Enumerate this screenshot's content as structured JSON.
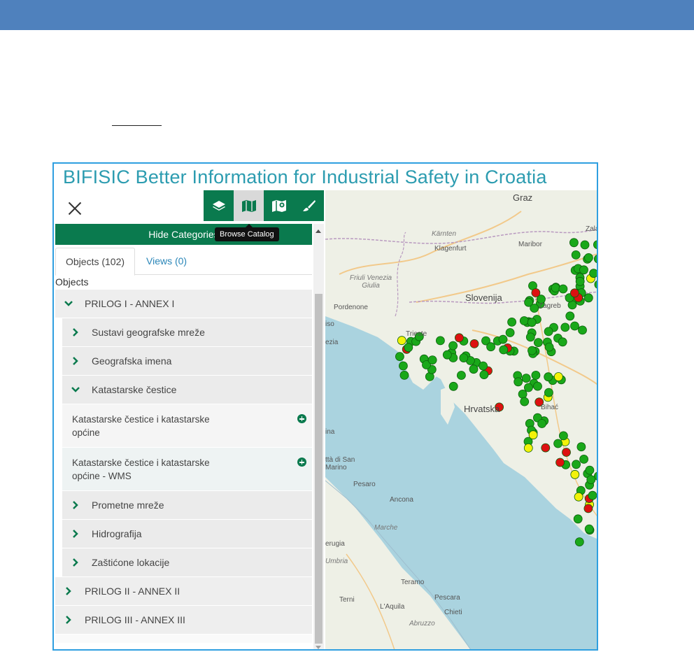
{
  "app": {
    "title": "BIFISIC Better Information for Industrial Safety in Croatia"
  },
  "toolbar": {
    "tools": [
      {
        "icon": "layers-icon"
      },
      {
        "icon": "map-icon"
      },
      {
        "icon": "map-search-icon"
      },
      {
        "icon": "brush-icon"
      }
    ],
    "tooltip": "Browse Catalog"
  },
  "panel": {
    "hide_categories": "Hide Categories",
    "tabs": [
      {
        "label": "Objects (102)"
      },
      {
        "label": "Views (0)"
      }
    ],
    "objects_heading": "Objects",
    "tree": {
      "annex1": "PRILOG I - ANNEX I",
      "annex1_children": [
        "Sustavi geografske mreže",
        "Geografska imena",
        "Katastarske čestice"
      ],
      "katastar_items": [
        "Katastarske čestice i katastarske općine",
        "Katastarske čestice i katastarske općine - WMS"
      ],
      "annex1_more": [
        "Prometne mreže",
        "Hidrografija",
        "Zaštićone lokacije"
      ],
      "annex2": "PRILOG II - ANNEX II",
      "annex3": "PRILOG III - ANNEX III"
    }
  },
  "map": {
    "labels": {
      "graz": "Graz",
      "karnten": "Kärnten",
      "klagenfurt": "Klagenfurt",
      "maribor": "Maribor",
      "zala": "Zala",
      "friuli": "Friuli Venezia\nGiulia",
      "slovenija": "Slovenija",
      "pordenone": "Pordenone",
      "iso": "iso",
      "trieste": "Trieste",
      "ezia": "ezia",
      "hrvatska": "Hrvatska",
      "bihac": "Bihać",
      "zagreb": "Zagreb",
      "ina": "ina",
      "san_marino": "ttà di San\nMarino",
      "pesaro": "Pesaro",
      "ancona": "Ancona",
      "marche": "Marche",
      "perugia": "erugia",
      "umbria": "Umbria",
      "teramo": "Teramo",
      "terni": "Terni",
      "pescara": "Pescara",
      "laquila": "L'Aquila",
      "chieti": "Chieti",
      "abruzzo": "Abruzzo"
    },
    "marker_colors": {
      "ok": "#1aa81a",
      "warn": "#f2f20a",
      "alert": "#dd1111"
    }
  },
  "colors": {
    "brand_green": "#0a7a4e",
    "title_teal": "#2c9cb0",
    "header_blue": "#4f81bd",
    "sea": "#aad3df"
  }
}
